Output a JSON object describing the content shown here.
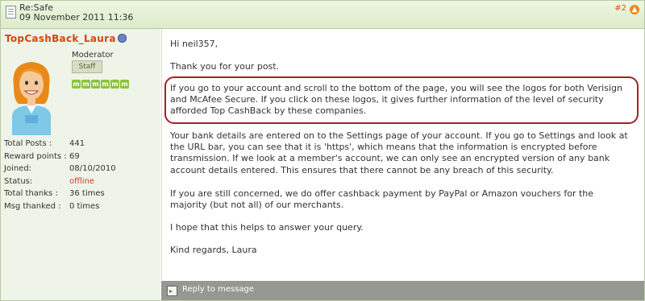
{
  "header": {
    "subject": "Re:Safe",
    "date": "09 November 2011 11:36",
    "post_number": "#2"
  },
  "author": {
    "username": "TopCashBack_Laura",
    "rank": "Moderator",
    "role_badge": "Staff",
    "badge_icons": [
      "m",
      "m",
      "m",
      "m",
      "m",
      "m"
    ],
    "stats": [
      {
        "label": "Total Posts :",
        "value": "441"
      },
      {
        "label": "Reward points :",
        "value": "69"
      },
      {
        "label": "Joined:",
        "value": "08/10/2010"
      },
      {
        "label": "Status:",
        "value": "offline"
      },
      {
        "label": "Total thanks :",
        "value": "36 times"
      },
      {
        "label": "Msg thanked :",
        "value": "0 times"
      }
    ]
  },
  "message": {
    "paragraphs": [
      "Hi neil357,",
      "Thank you for your post.",
      "If you go to your account and scroll to the bottom of the page, you will see the logos for both Verisign and McAfee Secure. If you click on these logos, it gives further information of the level of security afforded Top CashBack by these companies.",
      "Your bank details are entered on to the Settings page of your account. If you go to Settings and look at the URL bar, you can see that it is 'https', which means that the information is encrypted before transmission. If we look at a member's account, we can only see an encrypted version of any bank account details entered. This ensures that there cannot be any breach of this security.",
      "If you are still concerned, we do offer cashback payment by PayPal or Amazon vouchers for the majority (but not all) of our merchants.",
      "I hope that this helps to answer your query.",
      "Kind regards, Laura"
    ]
  },
  "footer": {
    "reply_label": "Reply to message"
  },
  "colors": {
    "username": "#d94410",
    "status_offline": "#e03434",
    "highlight_border": "#a2212b",
    "footer_bg": "#969892",
    "sidebar_bg": "#eef4e7"
  }
}
